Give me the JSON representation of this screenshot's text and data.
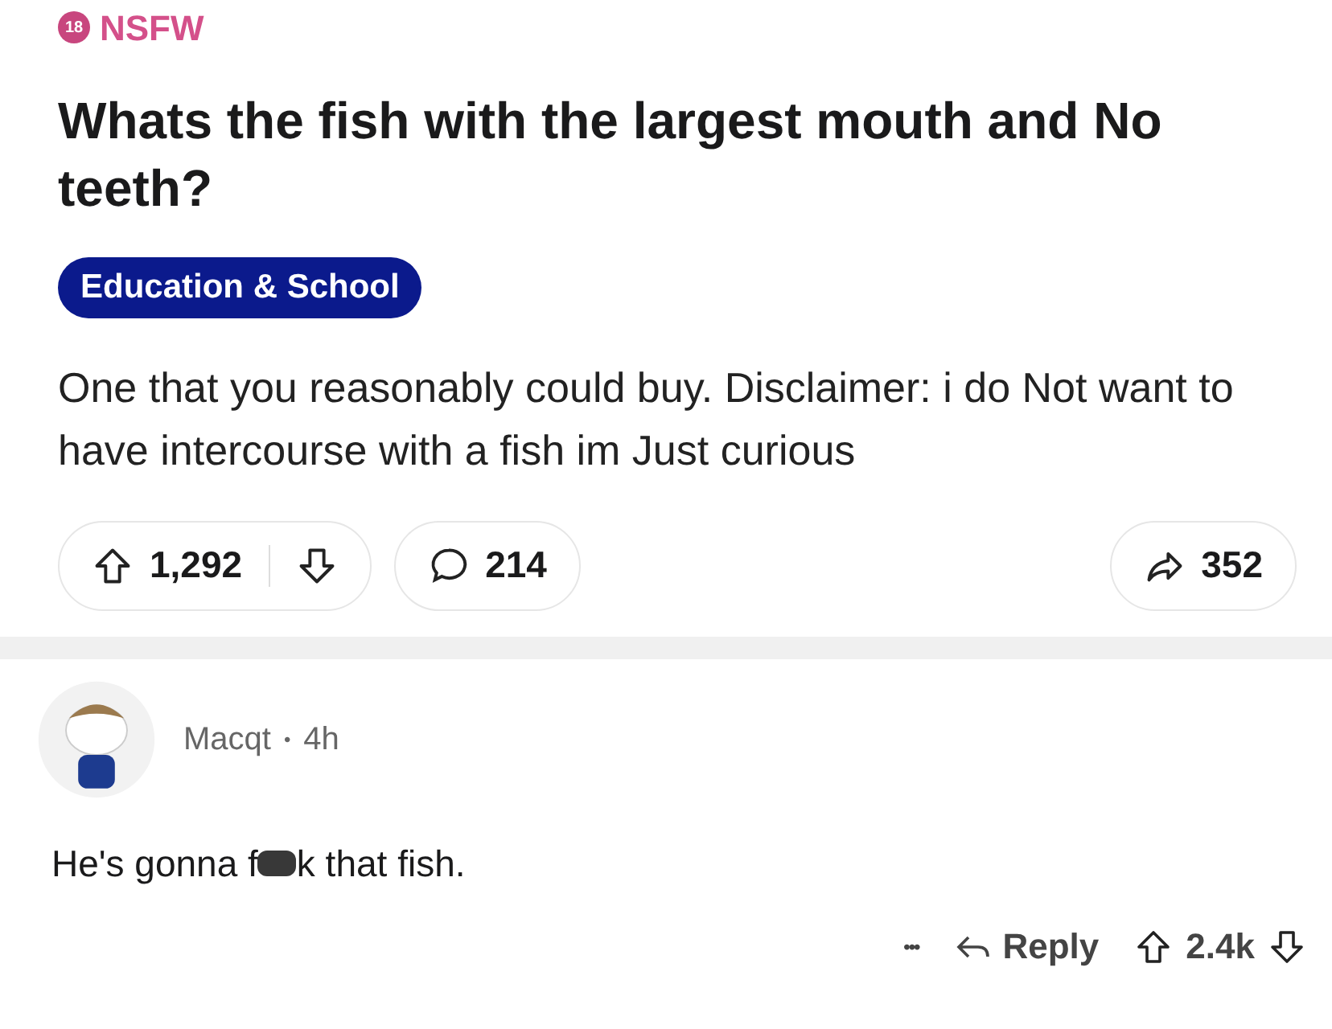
{
  "post": {
    "nsfw_badge": {
      "icon_text": "18",
      "label": "NSFW"
    },
    "title": "Whats the fish with the largest mouth and No teeth?",
    "flair": "Education & School",
    "body": "One that you reasonably could buy. Disclaimer: i do Not want to have intercourse with a fish im Just curious",
    "votes": "1,292",
    "comments": "214",
    "shares": "352"
  },
  "comment": {
    "author": "Macqt",
    "separator": "•",
    "age": "4h",
    "text_before": "He's gonna f",
    "text_after": "k that fish.",
    "more": "•••",
    "reply": "Reply",
    "votes": "2.4k"
  }
}
